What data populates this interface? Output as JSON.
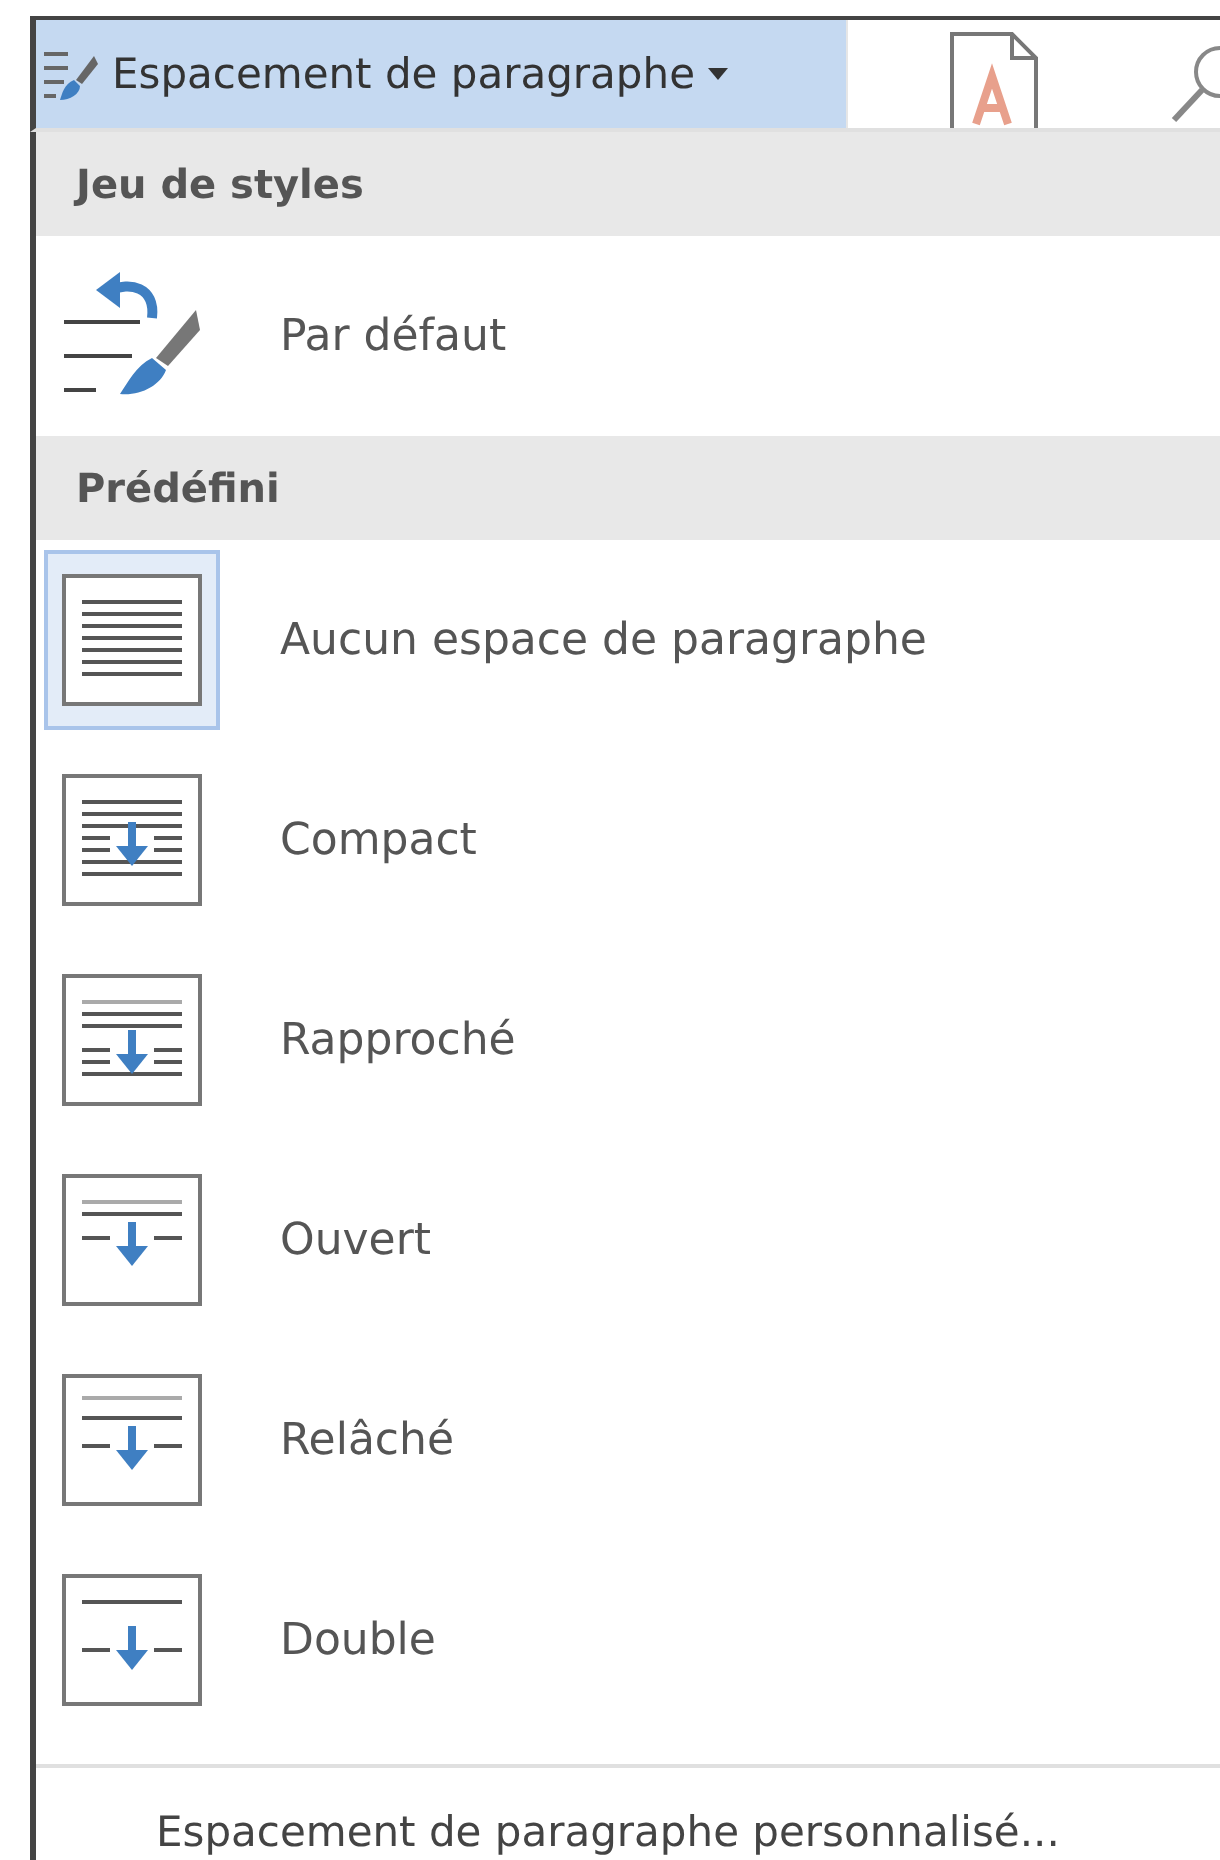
{
  "ribbon": {
    "button": {
      "label": "Espacement de paragraphe",
      "expanded": true
    }
  },
  "menu": {
    "sections": [
      {
        "header": "Jeu de styles",
        "items": [
          {
            "kind": "style",
            "label": "Par défaut",
            "selected": false
          }
        ]
      },
      {
        "header": "Prédéfini",
        "items": [
          {
            "kind": "none",
            "label": "Aucun espace de paragraphe",
            "selected": true
          },
          {
            "kind": "compact",
            "label": "Compact",
            "selected": false
          },
          {
            "kind": "tight",
            "label": "Rapproché",
            "selected": false
          },
          {
            "kind": "open",
            "label": "Ouvert",
            "selected": false
          },
          {
            "kind": "relaxed",
            "label": "Relâché",
            "selected": false
          },
          {
            "kind": "double",
            "label": "Double",
            "selected": false
          }
        ]
      }
    ],
    "footer": "Espacement de paragraphe personnalisé..."
  }
}
